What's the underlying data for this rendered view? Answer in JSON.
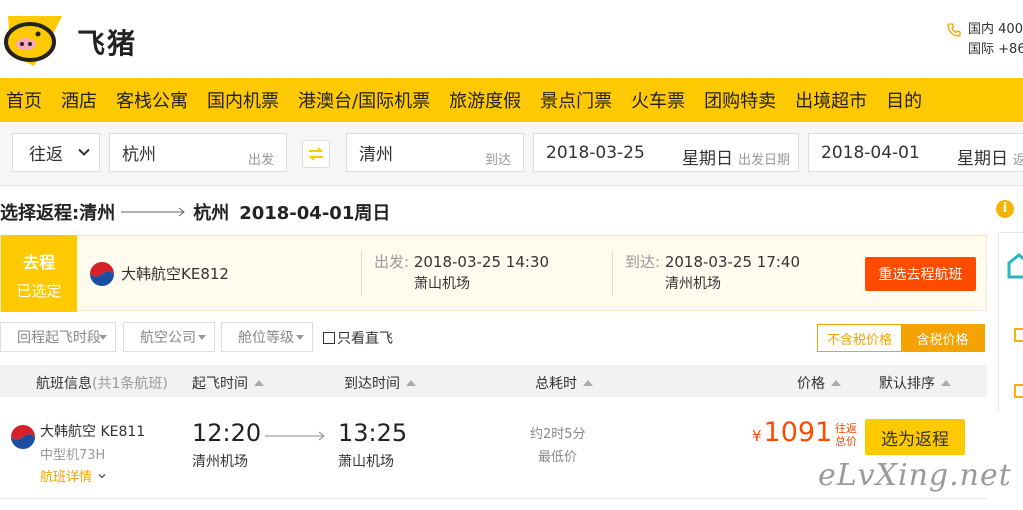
{
  "header": {
    "logo_text": "飞猪",
    "phone": {
      "domestic_label": "国内",
      "domestic_number": "400",
      "international_label": "国际",
      "international_number": "+86"
    }
  },
  "nav": {
    "items": [
      "首页",
      "酒店",
      "客栈公寓",
      "国内机票",
      "港澳台/国际机票",
      "旅游度假",
      "景点门票",
      "火车票",
      "团购特卖",
      "出境超市",
      "目的"
    ]
  },
  "search": {
    "trip_type": "往返",
    "from_city": "杭州",
    "from_hint": "出发",
    "to_city": "清州",
    "to_hint": "到达",
    "depart_date": "2018-03-25",
    "depart_weekday": "星期日",
    "depart_hint": "出发日期",
    "return_date": "2018-04-01",
    "return_weekday": "星期日",
    "return_hint": "返"
  },
  "route": {
    "prefix": "选择返程:",
    "from": "清州",
    "to": "杭州",
    "date": "2018-04-01周日"
  },
  "outbound": {
    "tag_line1": "去程",
    "tag_line2": "已选定",
    "airline": "大韩航空KE812",
    "depart_label": "出发:",
    "depart_time": "2018-03-25 14:30",
    "depart_airport": "萧山机场",
    "arrive_label": "到达:",
    "arrive_time": "2018-03-25 17:40",
    "arrive_airport": "清州机场",
    "reselect_label": "重选去程航班"
  },
  "filters": {
    "depart_time": "回程起飞时段",
    "airline": "航空公司",
    "cabin": "舱位等级",
    "direct_only": "只看直飞",
    "tax_excluded": "不含税价格",
    "tax_included": "含税价格"
  },
  "table": {
    "col_flight": "航班信息",
    "col_flight_sub": "(共1条航班)",
    "col_depart": "起飞时间",
    "col_arrive": "到达时间",
    "col_duration": "总耗时",
    "col_price": "价格",
    "col_default": "默认排序"
  },
  "flight": {
    "airline": "大韩航空 KE811",
    "plane": "中型机73H",
    "detail_label": "航班详情",
    "depart_time": "12:20",
    "depart_airport": "清州机场",
    "arrive_time": "13:25",
    "arrive_airport": "萧山机场",
    "duration": "约2时5分",
    "lowest_label": "最低价",
    "currency": "¥",
    "price": "1091",
    "price_note": "往返总价",
    "select_label": "选为返程"
  },
  "watermark": "eLvXing.net",
  "colors": {
    "brand_yellow": "#ffc900",
    "accent_orange": "#ff4a00",
    "toggle_orange": "#f5a300"
  },
  "icons": [
    "fliggy-logo-icon",
    "phone-icon",
    "chevron-down-icon",
    "swap-icon",
    "arrow-right-icon",
    "korean-air-logo-icon",
    "info-icon",
    "caret-down-icon",
    "sort-up-icon"
  ]
}
